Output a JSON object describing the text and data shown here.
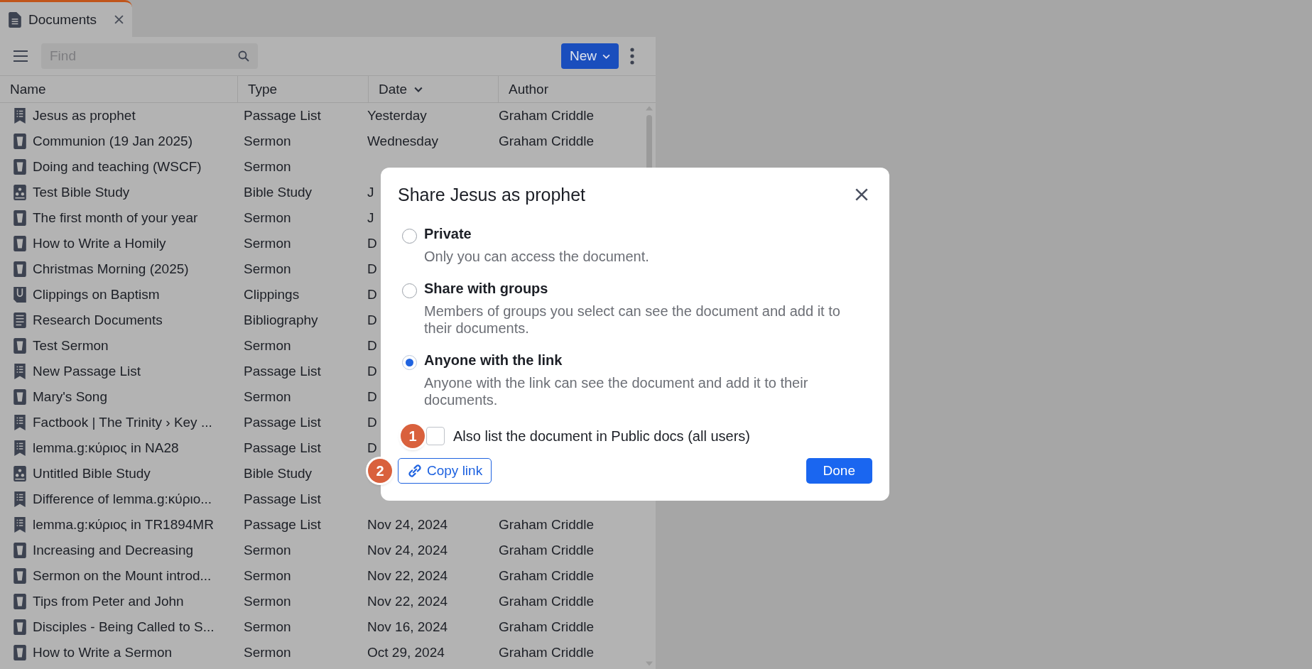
{
  "tab": {
    "title": "Documents",
    "selected": true
  },
  "toolbar": {
    "search": {
      "placeholder": "Find"
    },
    "new_button": "New"
  },
  "table": {
    "columns": [
      {
        "label": "Name",
        "sorted": false
      },
      {
        "label": "Type",
        "sorted": false
      },
      {
        "label": "Date",
        "sorted": true
      },
      {
        "label": "Author",
        "sorted": false
      }
    ],
    "rows": [
      {
        "kind": "passage",
        "name": "Jesus as prophet",
        "type": "Passage List",
        "date": "Yesterday",
        "author": "Graham Criddle"
      },
      {
        "kind": "sermon",
        "name": "Communion (19 Jan 2025)",
        "type": "Sermon",
        "date": "Wednesday",
        "author": "Graham Criddle"
      },
      {
        "kind": "sermon",
        "name": "Doing and teaching (WSCF)",
        "type": "Sermon"
      },
      {
        "kind": "study",
        "name": "Test Bible Study",
        "type": "Bible Study",
        "date": "J"
      },
      {
        "kind": "sermon",
        "name": "The first month of your year",
        "type": "Sermon",
        "date": "J"
      },
      {
        "kind": "sermon",
        "name": "How to Write a Homily",
        "type": "Sermon",
        "date": "D"
      },
      {
        "kind": "sermon",
        "name": "Christmas Morning (2025)",
        "type": "Sermon",
        "date": "D"
      },
      {
        "kind": "clippings",
        "name": "Clippings on Baptism",
        "type": "Clippings",
        "date": "D"
      },
      {
        "kind": "bibliography",
        "name": "Research Documents",
        "type": "Bibliography",
        "date": "D"
      },
      {
        "kind": "sermon",
        "name": "Test Sermon",
        "type": "Sermon",
        "date": "D"
      },
      {
        "kind": "passage",
        "name": "New Passage List",
        "type": "Passage List",
        "date": "D"
      },
      {
        "kind": "sermon",
        "name": "Mary's Song",
        "type": "Sermon",
        "date": "D"
      },
      {
        "kind": "passage",
        "name": "Factbook | The Trinity › Key ...",
        "type": "Passage List",
        "date": "D"
      },
      {
        "kind": "passage",
        "name": "lemma.g:κύριος in NA28",
        "type": "Passage List",
        "date": "D"
      },
      {
        "kind": "study",
        "name": "Untitled Bible Study",
        "type": "Bible Study"
      },
      {
        "kind": "passage",
        "name": "Difference of lemma.g:κύριο...",
        "type": "Passage List"
      },
      {
        "kind": "passage",
        "name": "lemma.g:κύριος in TR1894MR",
        "type": "Passage List",
        "date": "Nov 24, 2024",
        "author": "Graham Criddle"
      },
      {
        "kind": "sermon",
        "name": "Increasing and Decreasing",
        "type": "Sermon",
        "date": "Nov 24, 2024",
        "author": "Graham Criddle"
      },
      {
        "kind": "sermon",
        "name": "Sermon on the Mount introd...",
        "type": "Sermon",
        "date": "Nov 22, 2024",
        "author": "Graham Criddle"
      },
      {
        "kind": "sermon",
        "name": "Tips from Peter and John",
        "type": "Sermon",
        "date": "Nov 22, 2024",
        "author": "Graham Criddle"
      },
      {
        "kind": "sermon",
        "name": "Disciples - Being Called to S...",
        "type": "Sermon",
        "date": "Nov 16, 2024",
        "author": "Graham Criddle"
      },
      {
        "kind": "sermon",
        "name": "How to Write a Sermon",
        "type": "Sermon",
        "date": "Oct 29, 2024",
        "author": "Graham Criddle"
      }
    ]
  },
  "dialog": {
    "title": "Share Jesus as prophet",
    "options": [
      {
        "label": "Private",
        "description": "Only you can access the document.",
        "selected": false
      },
      {
        "label": "Share with groups",
        "description": "Members of groups you select can see the document and add it to their documents.",
        "selected": false
      },
      {
        "label": "Anyone with the link",
        "description": "Anyone with the link can see the document and add it to their documents.",
        "selected": true
      }
    ],
    "public_checkbox": {
      "label": "Also list the document in Public docs (all users)",
      "checked": false
    },
    "copy_link": "Copy link",
    "done": "Done"
  },
  "annotations": [
    {
      "label": "1"
    },
    {
      "label": "2"
    }
  ]
}
